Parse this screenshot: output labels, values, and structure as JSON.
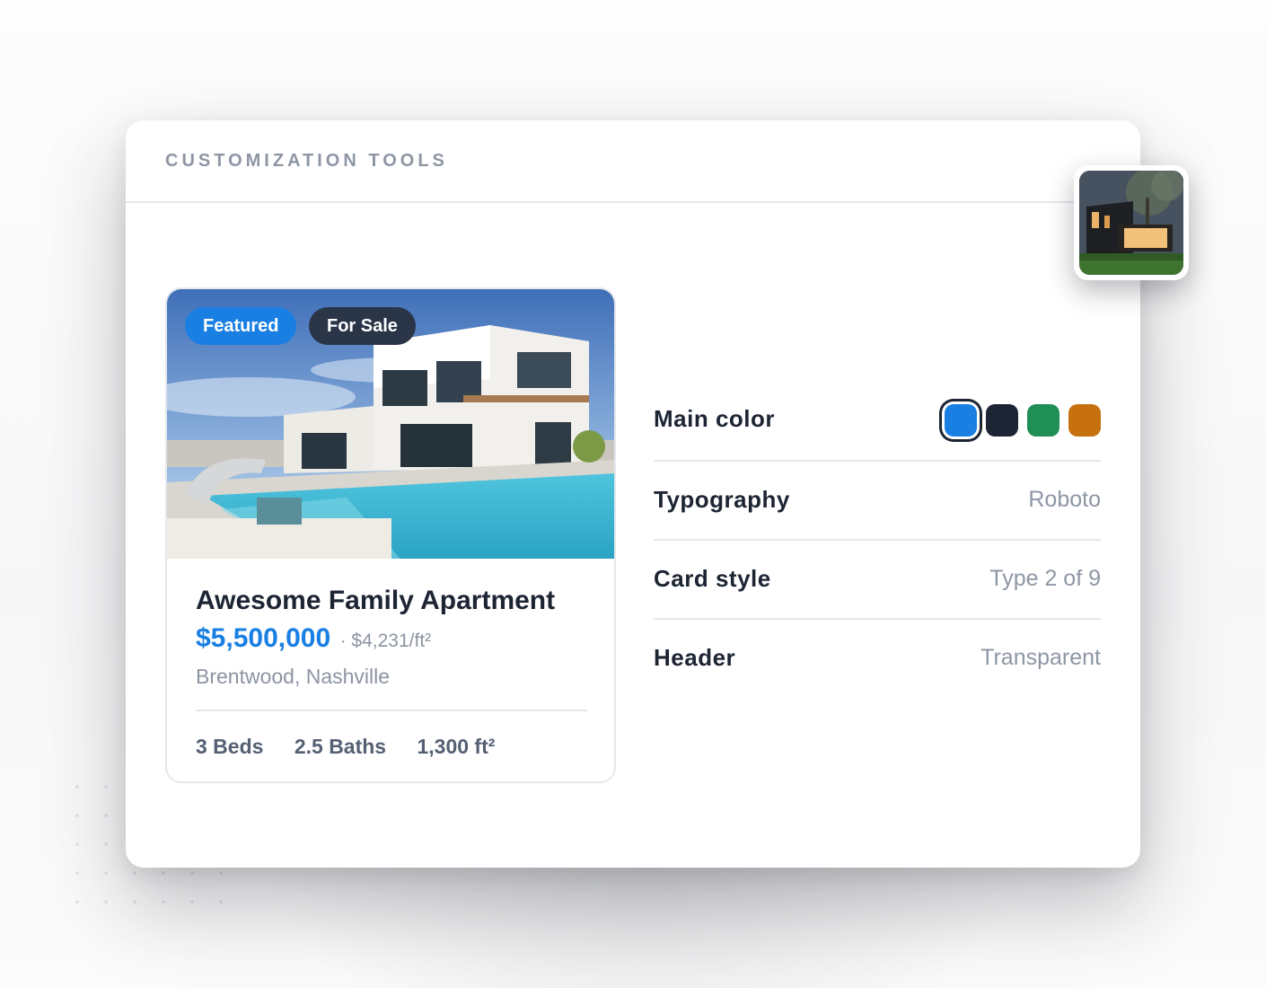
{
  "panel": {
    "title": "CUSTOMIZATION TOOLS"
  },
  "listing": {
    "badges": [
      "Featured",
      "For Sale"
    ],
    "title": "Awesome Family Apartment",
    "price": "$5,500,000",
    "price_per_sqft": "· $4,231/ft²",
    "location": "Brentwood, Nashville",
    "beds": "3 Beds",
    "baths": "2.5 Baths",
    "area": "1,300 ft²"
  },
  "settings": {
    "main_color": {
      "label": "Main color",
      "swatches": [
        "#1a7fe3",
        "#1d2433",
        "#1f8f55",
        "#c7700f"
      ],
      "selected_index": 0
    },
    "typography": {
      "label": "Typography",
      "value": "Roboto"
    },
    "card_style": {
      "label": "Card style",
      "value": "Type 2 of 9"
    },
    "header": {
      "label": "Header",
      "value": "Transparent"
    }
  }
}
